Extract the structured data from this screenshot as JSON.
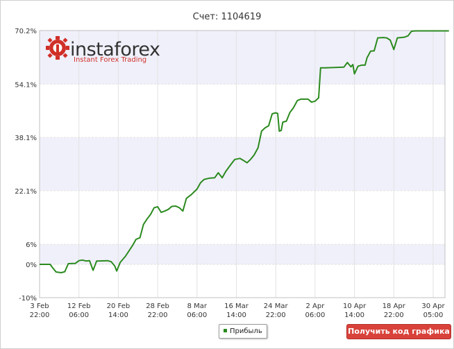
{
  "header": {
    "title": "Счет: 1104619"
  },
  "legend": {
    "label": "Прибыль"
  },
  "buttons": {
    "get_code": "Получить код графика"
  },
  "logo": {
    "word": "instaforex",
    "tagline": "Instant Forex Trading"
  },
  "colors": {
    "line": "#2a8a1e",
    "band": "#f0f0fb",
    "grid": "#e2e2e2",
    "accent_red": "#d8423a"
  },
  "chart_data": {
    "type": "line",
    "title": "Счет: 1104619",
    "xlabel": "",
    "ylabel": "",
    "grid": true,
    "legend": "bottom-center",
    "ylim": [
      -10,
      70.2
    ],
    "yticks": [
      {
        "value": 70.2,
        "label": "70.2%"
      },
      {
        "value": 54.1,
        "label": "54.1%"
      },
      {
        "value": 38.1,
        "label": "38.1%"
      },
      {
        "value": 22.1,
        "label": "22.1%"
      },
      {
        "value": 6,
        "label": "6%"
      },
      {
        "value": 0,
        "label": "0%"
      },
      {
        "value": -10,
        "label": "-10%"
      }
    ],
    "xticks": [
      {
        "value": 0,
        "line1": "3 Feb",
        "line2": "22:00"
      },
      {
        "value": 1,
        "line1": "12 Feb",
        "line2": "06:00"
      },
      {
        "value": 2,
        "line1": "20 Feb",
        "line2": "14:00"
      },
      {
        "value": 3,
        "line1": "28 Feb",
        "line2": "22:00"
      },
      {
        "value": 4,
        "line1": "8 Mar",
        "line2": "06:00"
      },
      {
        "value": 5,
        "line1": "16 Mar",
        "line2": "14:00"
      },
      {
        "value": 6,
        "line1": "24 Mar",
        "line2": "22:00"
      },
      {
        "value": 7,
        "line1": "2 Apr",
        "line2": "06:00"
      },
      {
        "value": 8,
        "line1": "10 Apr",
        "line2": "14:00"
      },
      {
        "value": 9,
        "line1": "18 Apr",
        "line2": "22:00"
      },
      {
        "value": 10,
        "line1": "30 Apr",
        "line2": "05:00"
      }
    ],
    "xlim": [
      0,
      10.4
    ],
    "series": [
      {
        "name": "Прибыль",
        "points": [
          [
            0.0,
            0.0
          ],
          [
            0.27,
            0.0
          ],
          [
            0.33,
            -1.0
          ],
          [
            0.42,
            -2.3
          ],
          [
            0.55,
            -2.5
          ],
          [
            0.64,
            -2.2
          ],
          [
            0.73,
            0.2
          ],
          [
            0.91,
            0.3
          ],
          [
            1.0,
            1.1
          ],
          [
            1.09,
            1.3
          ],
          [
            1.18,
            1.0
          ],
          [
            1.27,
            1.1
          ],
          [
            1.36,
            -1.8
          ],
          [
            1.45,
            1.0
          ],
          [
            1.73,
            1.1
          ],
          [
            1.82,
            0.8
          ],
          [
            1.91,
            -0.5
          ],
          [
            1.96,
            -2.0
          ],
          [
            2.05,
            0.6
          ],
          [
            2.18,
            2.4
          ],
          [
            2.36,
            5.6
          ],
          [
            2.45,
            7.5
          ],
          [
            2.55,
            8.0
          ],
          [
            2.64,
            12.0
          ],
          [
            2.73,
            13.6
          ],
          [
            2.82,
            15.0
          ],
          [
            2.91,
            17.0
          ],
          [
            3.0,
            17.3
          ],
          [
            3.09,
            15.6
          ],
          [
            3.18,
            16.0
          ],
          [
            3.27,
            16.5
          ],
          [
            3.36,
            17.4
          ],
          [
            3.46,
            17.5
          ],
          [
            3.55,
            17.0
          ],
          [
            3.64,
            16.0
          ],
          [
            3.73,
            19.8
          ],
          [
            3.86,
            21.0
          ],
          [
            4.0,
            22.6
          ],
          [
            4.09,
            24.5
          ],
          [
            4.18,
            25.5
          ],
          [
            4.32,
            25.9
          ],
          [
            4.45,
            26.0
          ],
          [
            4.54,
            27.5
          ],
          [
            4.64,
            26.0
          ],
          [
            4.73,
            27.9
          ],
          [
            4.86,
            30.0
          ],
          [
            4.96,
            31.5
          ],
          [
            5.09,
            31.8
          ],
          [
            5.18,
            31.2
          ],
          [
            5.27,
            30.5
          ],
          [
            5.36,
            31.5
          ],
          [
            5.45,
            32.8
          ],
          [
            5.55,
            35.0
          ],
          [
            5.64,
            40.0
          ],
          [
            5.73,
            41.0
          ],
          [
            5.82,
            41.6
          ],
          [
            5.91,
            45.2
          ],
          [
            6.0,
            45.5
          ],
          [
            6.05,
            45.3
          ],
          [
            6.09,
            40.0
          ],
          [
            6.14,
            40.2
          ],
          [
            6.18,
            42.7
          ],
          [
            6.27,
            43.0
          ],
          [
            6.36,
            45.6
          ],
          [
            6.45,
            47.0
          ],
          [
            6.55,
            49.2
          ],
          [
            6.64,
            49.6
          ],
          [
            6.82,
            49.6
          ],
          [
            6.91,
            48.7
          ],
          [
            7.0,
            49.0
          ],
          [
            7.09,
            50.0
          ],
          [
            7.14,
            59.0
          ],
          [
            7.23,
            59.0
          ],
          [
            7.27,
            59.0
          ],
          [
            7.73,
            59.2
          ],
          [
            7.82,
            60.6
          ],
          [
            7.91,
            59.3
          ],
          [
            7.96,
            60.0
          ],
          [
            8.0,
            57.2
          ],
          [
            8.09,
            59.5
          ],
          [
            8.18,
            59.8
          ],
          [
            8.27,
            59.8
          ],
          [
            8.32,
            62.0
          ],
          [
            8.41,
            64.0
          ],
          [
            8.5,
            64.1
          ],
          [
            8.59,
            68.0
          ],
          [
            8.73,
            68.1
          ],
          [
            8.82,
            68.0
          ],
          [
            8.91,
            67.3
          ],
          [
            9.0,
            64.5
          ],
          [
            9.09,
            68.0
          ],
          [
            9.27,
            68.2
          ],
          [
            9.36,
            68.6
          ],
          [
            9.45,
            70.0
          ],
          [
            9.55,
            70.1
          ],
          [
            10.4,
            70.1
          ]
        ]
      }
    ]
  }
}
